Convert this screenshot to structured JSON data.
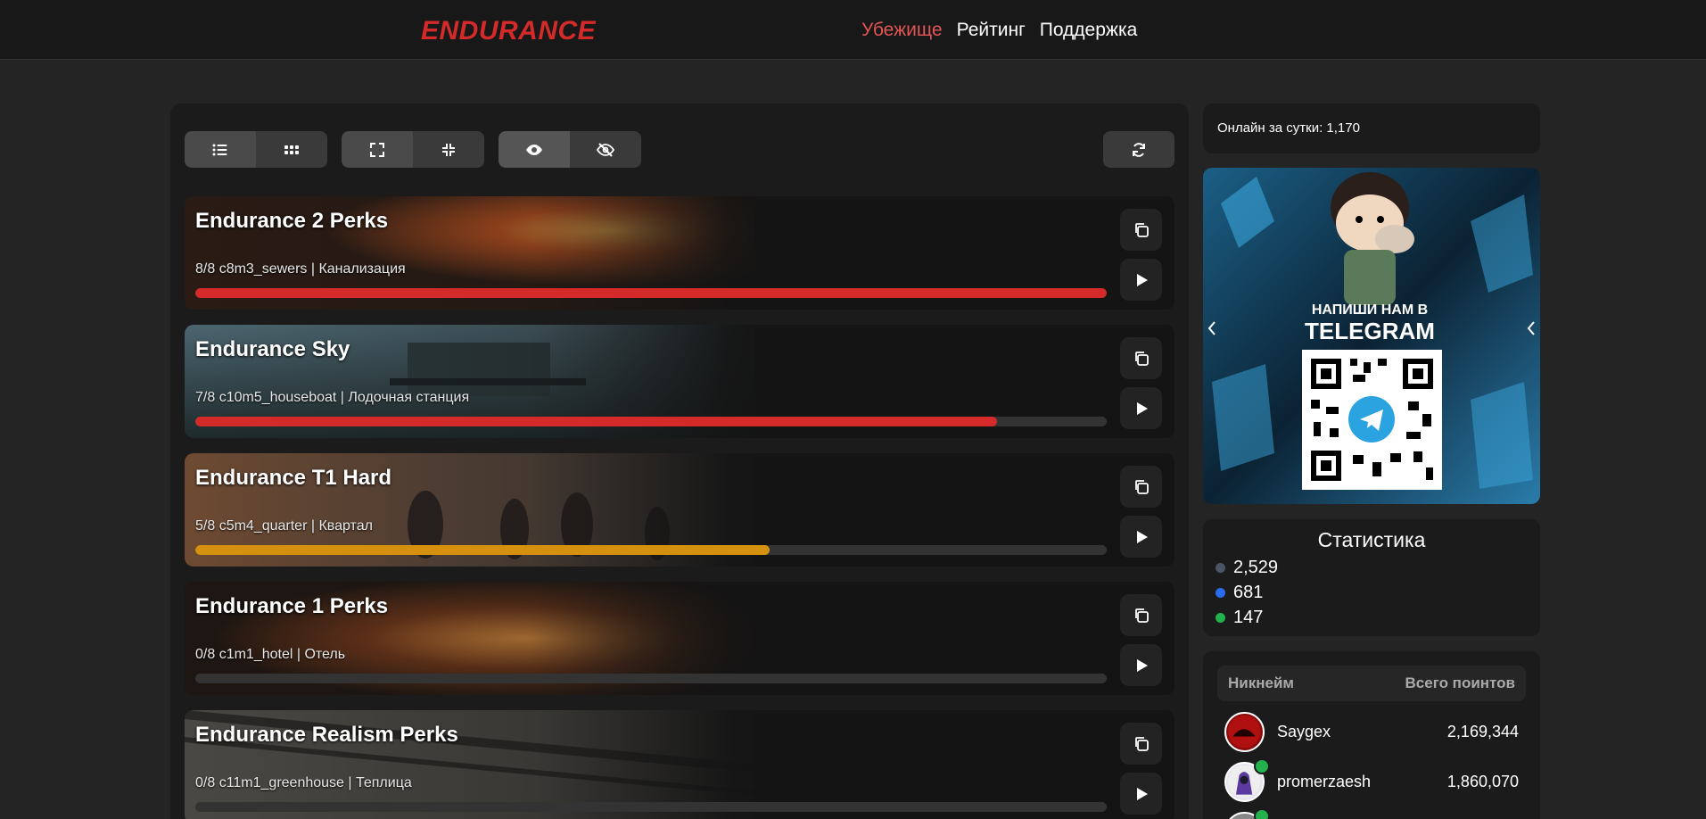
{
  "header": {
    "logo": "ENDURANCE",
    "nav": [
      {
        "label": "Убежище",
        "active": true
      },
      {
        "label": "Рейтинг",
        "active": false
      },
      {
        "label": "Поддержка",
        "active": false
      }
    ]
  },
  "toolbar": {
    "groups": [
      [
        "list-view-icon",
        "grid-view-icon"
      ],
      [
        "expand-icon",
        "collapse-icon"
      ],
      [
        "eye-icon",
        "eye-off-icon"
      ]
    ],
    "refresh_icon": "refresh-icon"
  },
  "servers": [
    {
      "name": "Endurance 2 Perks",
      "map": "8/8 c8m3_sewers | Канализация",
      "progress": 1.0,
      "color": "#d42a2a"
    },
    {
      "name": "Endurance Sky",
      "map": "7/8 c10m5_houseboat | Лодочная станция",
      "progress": 0.88,
      "color": "#d42a2a"
    },
    {
      "name": "Endurance T1 Hard",
      "map": "5/8 c5m4_quarter | Квартал",
      "progress": 0.63,
      "color": "#d4900e"
    },
    {
      "name": "Endurance 1 Perks",
      "map": "0/8 c1m1_hotel | Отель",
      "progress": 0,
      "color": "#d42a2a"
    },
    {
      "name": "Endurance Realism Perks",
      "map": "0/8 c11m1_greenhouse | Теплица",
      "progress": 0,
      "color": "#d42a2a"
    }
  ],
  "sidebar": {
    "online": "Онлайн за сутки: 1,170",
    "banner": {
      "line1": "НАПИШИ НАМ В",
      "line2": "TELEGRAM"
    },
    "stats": {
      "title": "Статистика",
      "items": [
        {
          "value": "2,529",
          "color": "#4a5566"
        },
        {
          "value": "681",
          "color": "#2a6cf0"
        },
        {
          "value": "147",
          "color": "#22b14c"
        }
      ]
    },
    "rating": {
      "col_name": "Никнейм",
      "col_points": "Всего поинтов",
      "players": [
        {
          "name": "Saygex",
          "points": "2,169,344"
        },
        {
          "name": "promerzaesh",
          "points": "1,860,070"
        }
      ]
    }
  }
}
